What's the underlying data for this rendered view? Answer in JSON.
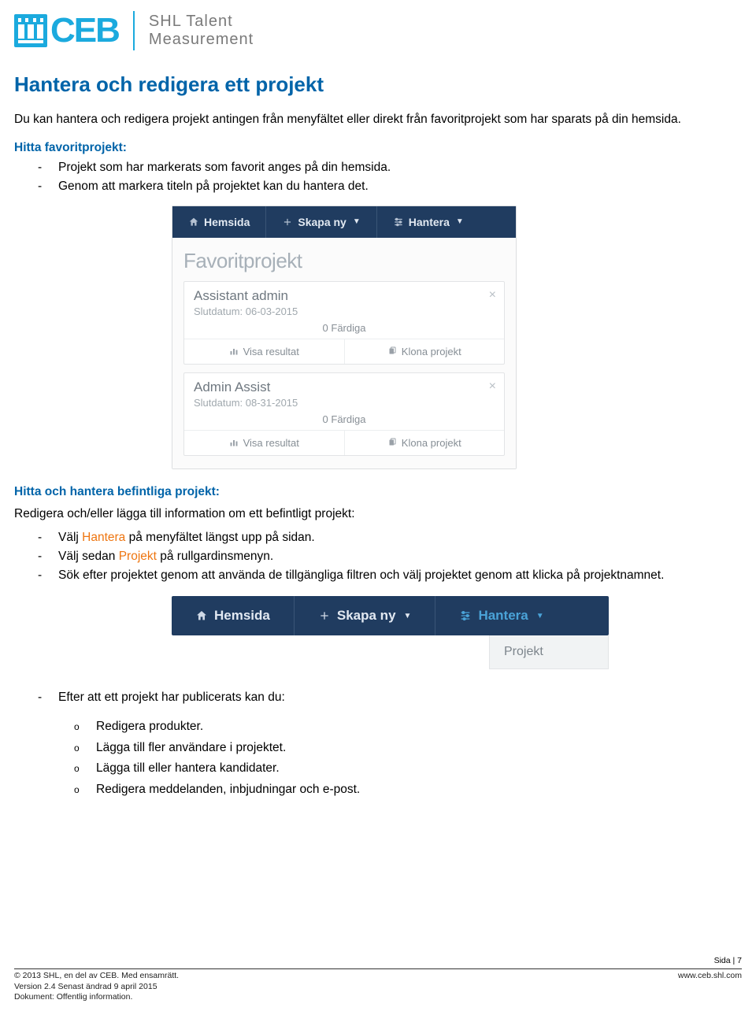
{
  "logo": {
    "ceb": "CEB",
    "tag1": "SHL Talent",
    "tag2": "Measurement"
  },
  "h1": "Hantera och redigera ett projekt",
  "intro": "Du kan hantera och redigera projekt antingen från menyfältet eller direkt från favoritprojekt som har sparats på din hemsida.",
  "sec1": {
    "heading": "Hitta favoritprojekt:",
    "items": [
      "Projekt som har markerats som favorit anges på din hemsida.",
      "Genom att markera titeln på projektet kan du hantera det."
    ]
  },
  "ss1": {
    "nav": {
      "home": "Hemsida",
      "create": "Skapa ny",
      "manage": "Hantera"
    },
    "title": "Favoritprojekt",
    "projects": [
      {
        "name": "Assistant admin",
        "date_label": "Slutdatum: 06-03-2015",
        "stat": "0 Färdiga",
        "view": "Visa resultat",
        "clone": "Klona projekt"
      },
      {
        "name": "Admin Assist",
        "date_label": "Slutdatum: 08-31-2015",
        "stat": "0 Färdiga",
        "view": "Visa resultat",
        "clone": "Klona projekt"
      }
    ]
  },
  "sec2": {
    "heading": "Hitta och hantera befintliga projekt:",
    "lede": "Redigera och/eller lägga till information om ett befintligt projekt:",
    "b1a": "Välj ",
    "b1b": "Hantera",
    "b1c": " på menyfältet längst upp på sidan.",
    "b2a": "Välj sedan ",
    "b2b": "Projekt",
    "b2c": " på rullgardinsmenyn.",
    "b3": "Sök efter projektet genom att använda de tillgängliga filtren och välj projektet genom att klicka på projektnamnet."
  },
  "ss2": {
    "nav": {
      "home": "Hemsida",
      "create": "Skapa ny",
      "manage": "Hantera"
    },
    "drop": "Projekt"
  },
  "sec3": {
    "b1": "Efter att ett projekt har publicerats kan du:",
    "subs": [
      "Redigera produkter.",
      "Lägga till fler användare i projektet.",
      "Lägga till eller hantera kandidater.",
      "Redigera meddelanden, inbjudningar och e-post."
    ]
  },
  "footer": {
    "page": "Sida | 7",
    "l1": "© 2013 SHL, en del av CEB. Med ensamrätt.",
    "l2": "Version 2.4  Senast ändrad 9 april 2015",
    "l3": "Dokument: Offentlig information.",
    "url": "www.ceb.shl.com"
  }
}
